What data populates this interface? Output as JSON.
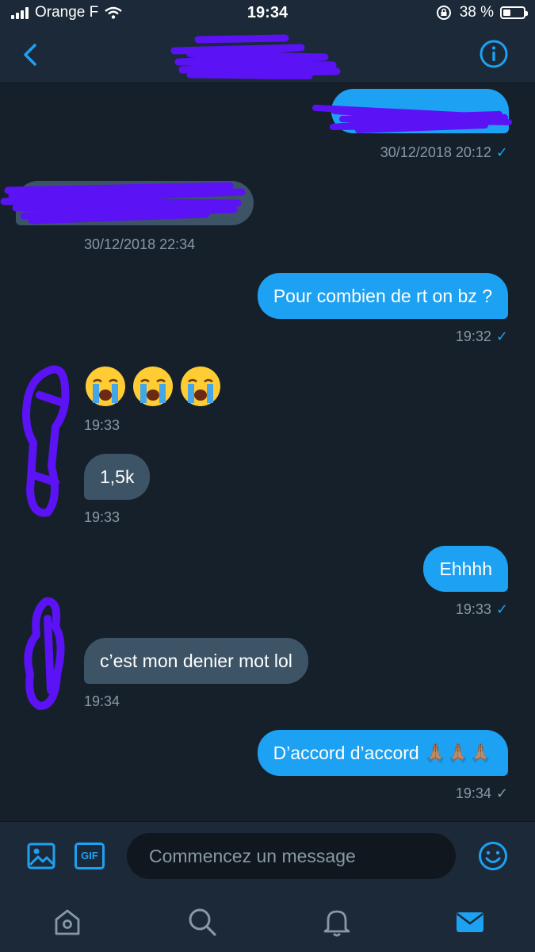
{
  "status_bar": {
    "carrier": "Orange F",
    "time": "19:34",
    "battery_percent": "38 %",
    "battery_level": 0.38
  },
  "header": {
    "back_icon": "chevron-left-icon",
    "info_icon": "info-icon"
  },
  "messages": [
    {
      "direction": "outgoing",
      "text": "",
      "timestamp": "30/12/2018 20:12",
      "read": true
    },
    {
      "direction": "incoming",
      "text": "",
      "timestamp": "30/12/2018 22:34"
    },
    {
      "direction": "outgoing",
      "text": "Pour combien de rt on bz ?",
      "timestamp": "19:32",
      "read": true
    },
    {
      "direction": "incoming",
      "text": "😭😭😭",
      "timestamp": "19:33"
    },
    {
      "direction": "incoming",
      "text": "1,5k",
      "timestamp": "19:33"
    },
    {
      "direction": "outgoing",
      "text": "Ehhhh",
      "timestamp": "19:33",
      "read": true
    },
    {
      "direction": "incoming",
      "text": "c’est mon denier mot lol",
      "timestamp": "19:34"
    },
    {
      "direction": "outgoing",
      "text": "D’accord d’accord 🙏🏽🙏🏽🙏🏽",
      "timestamp": "19:34",
      "read": false
    }
  ],
  "check_mark": "✓",
  "composer": {
    "placeholder": "Commencez un message",
    "gif_label": "GIF"
  },
  "tabs": [
    "home-icon",
    "search-icon",
    "notifications-icon",
    "messages-icon"
  ],
  "colors": {
    "background": "#15202b",
    "bar": "#1c2938",
    "accent": "#1da1f2",
    "incoming_bubble": "#3d5466",
    "secondary_text": "#8899a6",
    "redaction": "#5b12f5"
  }
}
